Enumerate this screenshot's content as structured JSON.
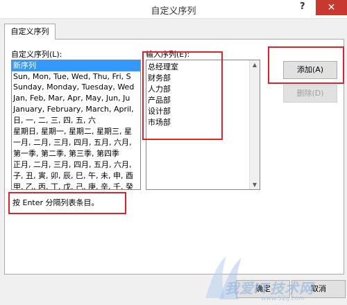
{
  "window": {
    "title": "自定义序列",
    "help_glyph": "?",
    "close_glyph": "✕"
  },
  "tab": {
    "label": "自定义序列"
  },
  "left_list": {
    "label": "自定义序列(L):",
    "items": [
      "新序列",
      "Sun, Mon, Tue, Wed, Thu, Fri, S",
      "Sunday, Monday, Tuesday, Wed",
      "Jan, Feb, Mar, Apr, May, Jun, Ju",
      "January, February, March, April,",
      "日, 一, 二, 三, 四, 五, 六",
      "星期日, 星期一, 星期二, 星期三, 星",
      "一月, 二月, 三月, 四月, 五月, 六月,",
      "第一季, 第二季, 第三季, 第四季",
      "正月, 二月, 三月, 四月, 五月, 六月,",
      "子, 丑, 寅, 卯, 辰, 巳, 午, 未, 申, 酉",
      "甲, 乙, 丙, 丁, 戊, 己, 庚, 辛, 壬, 癸"
    ],
    "selected_index": 0
  },
  "right_list": {
    "label": "输入序列(E):",
    "items": [
      "总经理室",
      "财务部",
      "人力部",
      "产品部",
      "设计部",
      "市场部"
    ]
  },
  "buttons": {
    "add": "添加(A)",
    "delete": "删除(D)",
    "ok": "确定",
    "cancel": "取消"
  },
  "hint": "按 Enter 分隔列表条目。",
  "watermark": {
    "text": "我爱IT技术网",
    "url": "www.52ij.com"
  },
  "colors": {
    "highlight_box": "#e0202a",
    "selection": "#3399ff",
    "close_button": "#c7392e"
  }
}
